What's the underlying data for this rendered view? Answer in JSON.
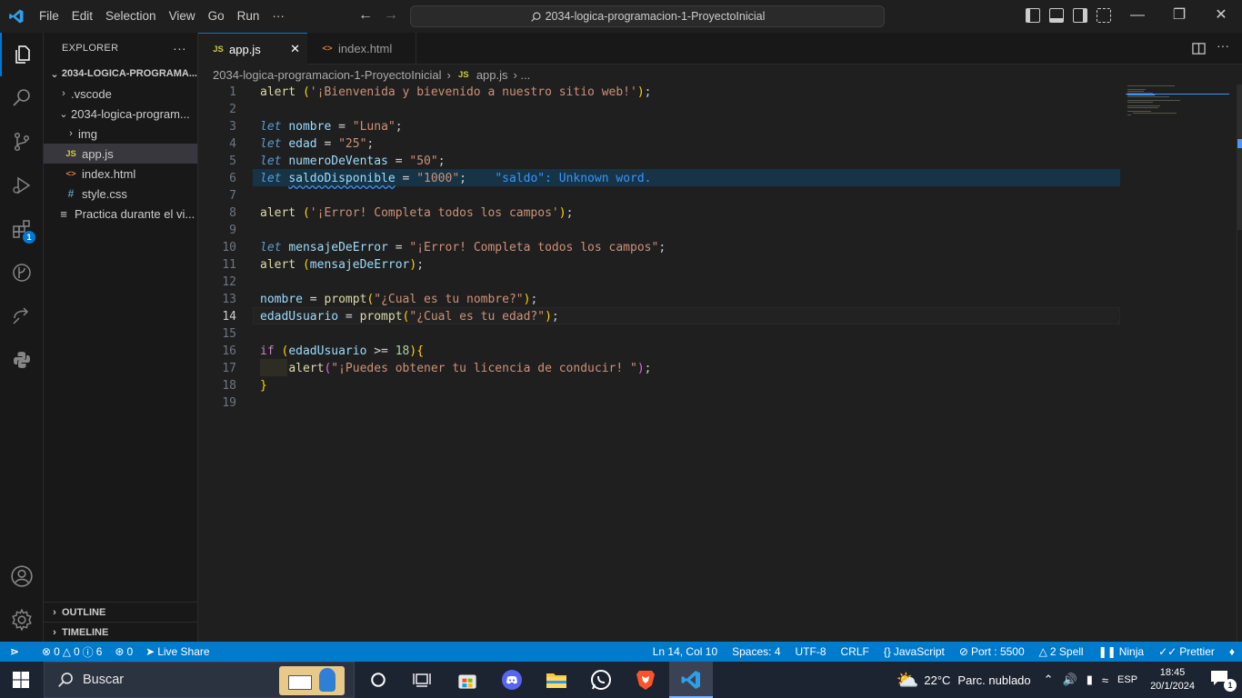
{
  "titlebar": {
    "menu": [
      "File",
      "Edit",
      "Selection",
      "View",
      "Go",
      "Run",
      "···"
    ],
    "command_center": "2034-logica-programacion-1-ProyectoInicial",
    "win_minimize": "—",
    "win_restore": "❐",
    "win_close": "✕"
  },
  "activitybar": {
    "extensions_badge": "1"
  },
  "sidebar": {
    "header": "EXPLORER",
    "header_more": "···",
    "root_folder": "2034-LOGICA-PROGRAMA...",
    "items": [
      {
        "label": ".vscode",
        "icon": "",
        "chevron": "›"
      },
      {
        "label": "2034-logica-program...",
        "icon": "",
        "chevron": "⌵"
      },
      {
        "label": "img",
        "icon": "",
        "chevron": "›"
      },
      {
        "label": "app.js",
        "icon": "JS"
      },
      {
        "label": "index.html",
        "icon": "<>"
      },
      {
        "label": "style.css",
        "icon": "#"
      },
      {
        "label": "Practica durante el vi...",
        "icon": "≡"
      }
    ],
    "outline": "OUTLINE",
    "timeline": "TIMELINE"
  },
  "tabs": [
    {
      "label": "app.js",
      "icon": "JS",
      "close": "✕"
    },
    {
      "label": "index.html",
      "icon": "<>"
    }
  ],
  "breadcrumb": {
    "folder": "2034-logica-programacion-1-ProyectoInicial",
    "sep": "›",
    "file_icon": "JS",
    "file": "app.js",
    "more": "› ..."
  },
  "editor": {
    "line_numbers": [
      "1",
      "2",
      "3",
      "4",
      "5",
      "6",
      "7",
      "8",
      "9",
      "10",
      "11",
      "12",
      "13",
      "14",
      "15",
      "16",
      "17",
      "18",
      "19"
    ],
    "current_line": 14,
    "diagnostic": "\"saldo\": Unknown word."
  },
  "statusbar": {
    "errors": "0",
    "warnings": "0",
    "info": "6",
    "ports": "0",
    "live_share": "Live Share",
    "position": "Ln 14, Col 10",
    "spaces": "Spaces: 4",
    "encoding": "UTF-8",
    "eol": "CRLF",
    "language": "JavaScript",
    "port": "Port : 5500",
    "spell": "2 Spell",
    "ninja": "Ninja",
    "prettier": "Prettier"
  },
  "taskbar": {
    "search_placeholder": "Buscar",
    "weather_temp": "22°C",
    "weather_desc": "Parc. nublado",
    "language": "ESP",
    "time": "18:45",
    "date": "20/1/2024",
    "notif_count": "1"
  },
  "colors": {
    "accent": "#007acc",
    "tab_active_border": "#0078d4",
    "js_icon": "#cbcb41",
    "html_icon": "#e37933",
    "css_icon": "#519aba"
  }
}
